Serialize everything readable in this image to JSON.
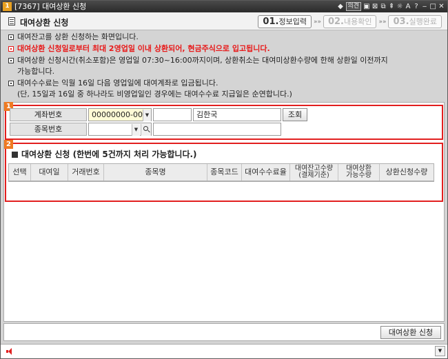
{
  "window": {
    "icon_label": "1",
    "title": "[7367] 대여상환 신청",
    "tools": [
      "◆",
      "의견",
      "▣",
      "⊠",
      "⧉",
      "⇞",
      "☼",
      "A",
      "?",
      "‒",
      "□",
      "✕"
    ]
  },
  "header": {
    "screen_title": "대여상환 신청",
    "steps": [
      {
        "num": "01.",
        "label": "정보입력"
      },
      {
        "num": "02.",
        "label": "내용확인"
      },
      {
        "num": "03.",
        "label": "실행완료"
      }
    ],
    "arrow": "»»"
  },
  "notes": [
    {
      "text": "대여잔고를 상환 신청하는 화면입니다."
    },
    {
      "text": "대여상환 신청일로부터 최대 2영업일 이내 상환되어, 현금주식으로 입고됩니다."
    },
    {
      "text": "대여상환 신청시간(취소포함)은 영업일 07:30~16:00까지이며, 상환취소는 대여미상환수량에 한해 상환일 이전까지",
      "text2": "가능합니다."
    },
    {
      "text": "대여수수료는 익월 16일 다음 영업일에 대여계좌로 입금됩니다.",
      "text2": "(단, 15일과 16일 중 하나라도 비영업일인 경우에는 대여수수료 지급일은 순연합니다.)"
    }
  ],
  "section1": {
    "num": "1",
    "account_label": "계좌번호",
    "account_value": "00000000-00",
    "password_value": "",
    "account_name": "김한국",
    "lookup_button": "조회",
    "stock_label": "종목번호",
    "stock_code_value": "",
    "stock_name_value": ""
  },
  "section2": {
    "num": "2",
    "title": "대여상환 신청 (한번에 5건까지 처리 가능합니다.)",
    "columns": [
      {
        "line1": "선택"
      },
      {
        "line1": "대여일"
      },
      {
        "line1": "거래번호"
      },
      {
        "line1": "종목명"
      },
      {
        "line1": "종목코드"
      },
      {
        "line1": "대여수수료율"
      },
      {
        "line1": "대여잔고수량",
        "line2": "(결제기준)"
      },
      {
        "line1": "대여상환",
        "line2": "가능수량"
      },
      {
        "line1": "상환신청수량"
      }
    ]
  },
  "footer": {
    "submit_button": "대여상환 신청"
  },
  "colors": {
    "section_border": "#e21e1e",
    "notice_red": "#e81818",
    "section_badge": "#ef7a22"
  }
}
